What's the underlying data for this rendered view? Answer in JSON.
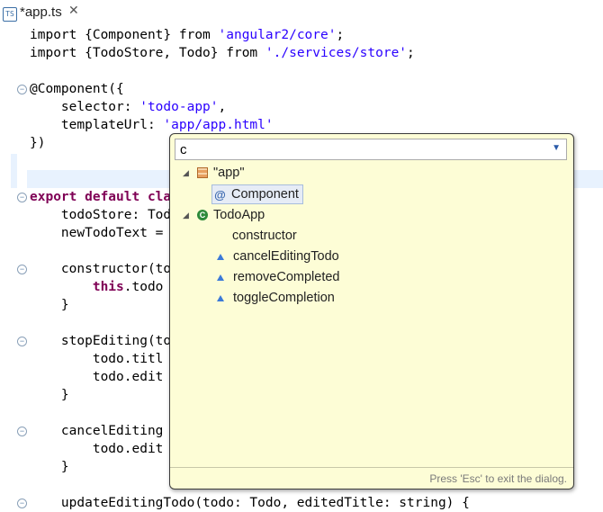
{
  "tab": {
    "title": "*app.ts",
    "icon": "ts-file-icon",
    "close_icon": "close-icon"
  },
  "code": {
    "l1_a": "import {Component} from ",
    "l1_b": "'angular2/core'",
    "l1_c": ";",
    "l2_a": "import {TodoStore, Todo} from ",
    "l2_b": "'./services/store'",
    "l2_c": ";",
    "l4": "@Component({",
    "l5_a": "    selector: ",
    "l5_b": "'todo-app'",
    "l5_c": ",",
    "l6_a": "    templateUrl: ",
    "l6_b": "'app/app.html'",
    "l7": "})",
    "l9_a": "export default",
    "l9_b": " cla",
    "l10": "    todoStore: Tod",
    "l11": "    newTodoText =",
    "l13": "    constructor(to",
    "l14_a": "        ",
    "l14_b": "this",
    "l14_c": ".todo",
    "l15": "    }",
    "l17": "    stopEditing(to",
    "l18": "        todo.titl",
    "l19": "        todo.edit",
    "l20": "    }",
    "l22": "    cancelEditing",
    "l23": "        todo.edit",
    "l24": "    }",
    "l26": "    updateEditingTodo(todo: Todo, editedTitle: string) {"
  },
  "popup": {
    "filter_value": "c",
    "dropdown_icon": "chevron-down-icon",
    "tree": [
      {
        "label": "\"app\"",
        "icon": "package-icon"
      },
      {
        "label": "Component",
        "icon": "annotation-icon"
      },
      {
        "label": "TodoApp",
        "icon": "class-icon"
      },
      {
        "label": "constructor",
        "icon": ""
      },
      {
        "label": "cancelEditingTodo",
        "icon": "method-icon"
      },
      {
        "label": "removeCompleted",
        "icon": "method-icon"
      },
      {
        "label": "toggleCompletion",
        "icon": "method-icon"
      }
    ],
    "footer": "Press 'Esc' to exit the dialog."
  },
  "colors": {
    "keyword": "#7f0055",
    "string": "#2a00ff",
    "popup_bg": "#fdfdd6",
    "current_line": "#e8f2fe"
  }
}
